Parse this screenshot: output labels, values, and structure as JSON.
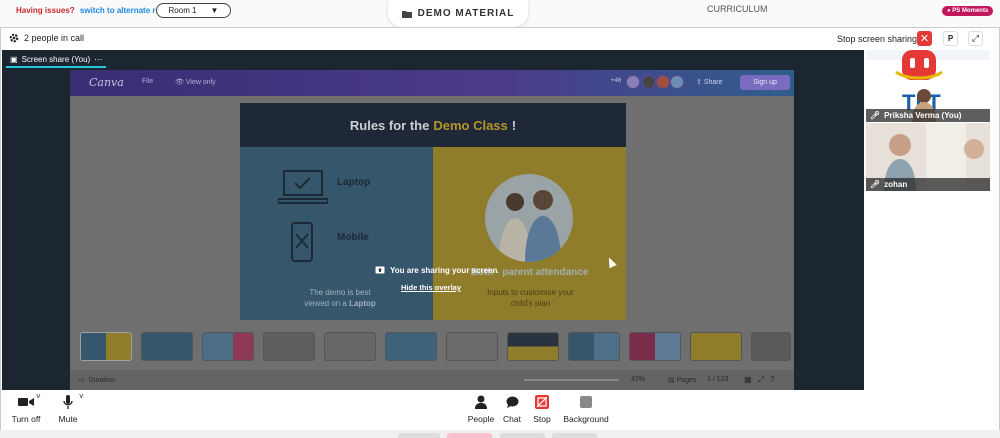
{
  "topbar": {
    "issues_text": "Having issues?",
    "alternate_link": "switch to alternate room",
    "room": "Room 1",
    "demo_material": "DEMO MATERIAL",
    "curriculum": "CURRICULUM",
    "ps_moments": "PS Moments"
  },
  "call": {
    "people_count": "2 people in call",
    "stop_sharing": "Stop screen sharing",
    "p_button": "P"
  },
  "stage": {
    "share_tab": "Screen share (You)",
    "overlay_message": "You are sharing your screen",
    "hide_overlay": "Hide this overlay"
  },
  "canva": {
    "logo": "Canva",
    "file": "File",
    "view_only": "View only",
    "avatar_count": "+46",
    "share": "Share",
    "sign_up": "Sign up",
    "footer": {
      "duration": "Duration",
      "zoom": "43%",
      "pages": "Pages",
      "page_num": "1 / 123"
    }
  },
  "slide": {
    "title_pre": "Rules for the",
    "title_highlight": "Demo Class",
    "title_post": "!",
    "laptop": "Laptop",
    "mobile": "Mobile",
    "demo_best_line1": "The demo is best",
    "demo_best_line2_pre": "viewed on a",
    "demo_best_line2_bold": "Laptop",
    "both_parent": "Both - parent attendance",
    "inputs_line1": "Inputs to customise your",
    "inputs_line2": "child's plan"
  },
  "participants": [
    {
      "name": "Priksha Verma (You)"
    },
    {
      "name": "zohan"
    }
  ],
  "controls": {
    "turn_off": "Turn off",
    "mute": "Mute",
    "people": "People",
    "chat": "Chat",
    "stop": "Stop",
    "background": "Background"
  },
  "colors": {
    "stop_red": "#e53935",
    "link_blue": "#1e88e5",
    "issue_red": "#c62828",
    "accent_teal": "#26c6da"
  }
}
